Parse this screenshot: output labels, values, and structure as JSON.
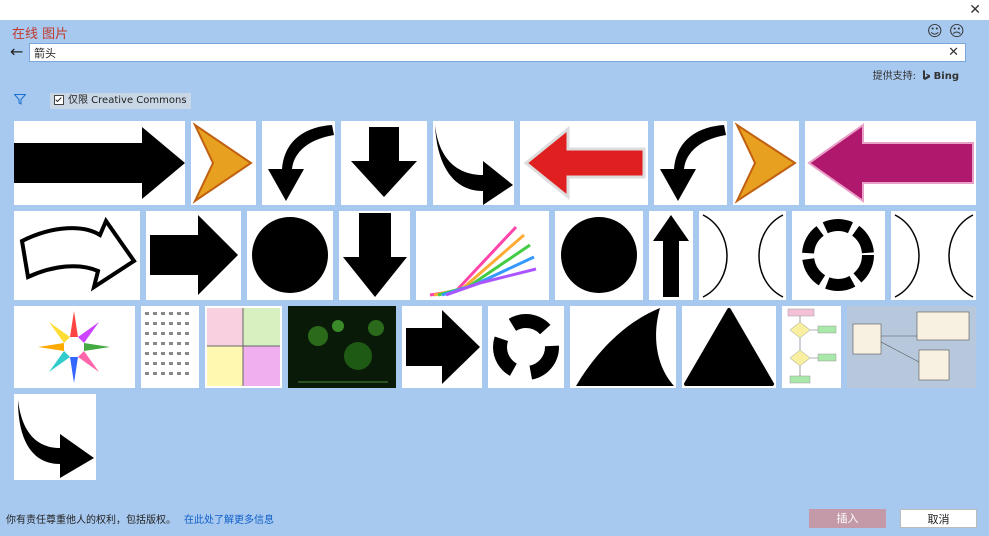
{
  "window": {
    "close_glyph": "✕"
  },
  "header": {
    "title": "在线 图片",
    "smile_glyph": "☺",
    "frown_glyph": "☹"
  },
  "search": {
    "back_glyph": "←",
    "value": "箭头",
    "clear_glyph": "✕"
  },
  "powered_by": {
    "label": "提供支持:",
    "brand": "Bing"
  },
  "filter": {
    "creative_commons_label": "仅限 Creative Commons",
    "checked": true
  },
  "footer": {
    "notice": "你有责任尊重他人的权利，包括版权。",
    "link": "在此处了解更多信息",
    "insert_label": "插入",
    "cancel_label": "取消"
  },
  "colors": {
    "background": "#a8c9ef",
    "title": "#c0392b",
    "link": "#0f5fc9",
    "insert_disabled": "#c49aa8"
  },
  "results": [
    {
      "name": "arrow-right-black"
    },
    {
      "name": "chevron-orange"
    },
    {
      "name": "curved-arrow-down-left"
    },
    {
      "name": "arrow-down-black"
    },
    {
      "name": "curved-arrow-down-right"
    },
    {
      "name": "arrow-left-red"
    },
    {
      "name": "curved-arrow-down-left-2"
    },
    {
      "name": "chevron-orange-2"
    },
    {
      "name": "arrow-left-magenta"
    },
    {
      "name": "arrow-outline-3d"
    },
    {
      "name": "arrow-right-black-2"
    },
    {
      "name": "black-circle"
    },
    {
      "name": "arrow-down-black-2"
    },
    {
      "name": "colorful-arrows-3d"
    },
    {
      "name": "black-circle-2"
    },
    {
      "name": "arrow-up-black"
    },
    {
      "name": "curved-arrows-brackets"
    },
    {
      "name": "circular-arrows"
    },
    {
      "name": "curved-arrows-brackets-2"
    },
    {
      "name": "colorful-arrow-burst"
    },
    {
      "name": "arrow-symbol-grid"
    },
    {
      "name": "color-cube-diagram"
    },
    {
      "name": "green-microscopy"
    },
    {
      "name": "arrow-right-black-3"
    },
    {
      "name": "recycle-arrows"
    },
    {
      "name": "curved-triangle"
    },
    {
      "name": "black-triangle"
    },
    {
      "name": "flowchart"
    },
    {
      "name": "uml-diagram"
    },
    {
      "name": "curved-arrow-down-right-2"
    }
  ]
}
